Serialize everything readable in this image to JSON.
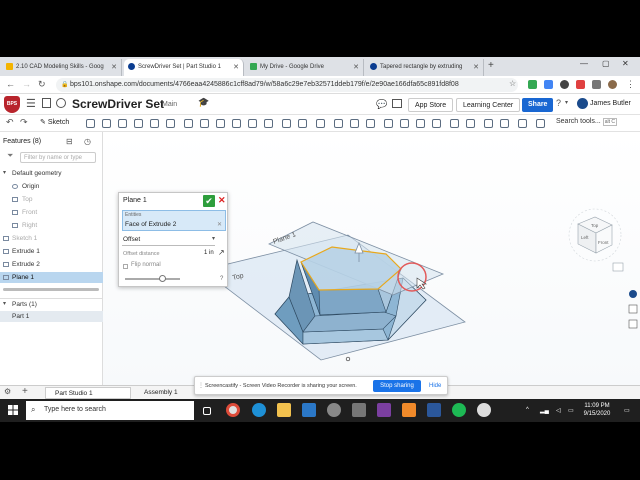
{
  "browser": {
    "tabs": [
      {
        "label": "2.10 CAD Modeling Skills - Goog",
        "color": "#f4b400",
        "active": false
      },
      {
        "label": "ScrewDriver Set | Part Studio 1",
        "color": "#0b3d91",
        "active": true
      },
      {
        "label": "My Drive - Google Drive",
        "color": "#34a853",
        "active": false
      },
      {
        "label": "Tapered rectangle by extruding",
        "color": "#0b3d91",
        "active": false
      }
    ],
    "url": "bps101.onshape.com/documents/4766eaa4245886c1cff8ad79/w/58a6c29e7eb32571ddeb179f/e/2e90ae166dfa65c891fd8f08"
  },
  "onshape": {
    "logo_text": "BPS",
    "doc_title": "ScrewDriver Set",
    "branch": "Main",
    "app_store": "App Store",
    "learning_center": "Learning Center",
    "share": "Share",
    "user": "James Butler",
    "sketch": "Sketch",
    "search_tools": "Search tools...",
    "search_shortcut": "alt C"
  },
  "features": {
    "title": "Features (8)",
    "filter_placeholder": "Filter by name or type",
    "items": [
      {
        "label": "Default geometry",
        "state": "normal"
      },
      {
        "label": "Origin",
        "state": "normal"
      },
      {
        "label": "Top",
        "state": "dim"
      },
      {
        "label": "Front",
        "state": "dim"
      },
      {
        "label": "Right",
        "state": "dim"
      },
      {
        "label": "Sketch 1",
        "state": "dim"
      },
      {
        "label": "Extrude 1",
        "state": "normal"
      },
      {
        "label": "Extrude 2",
        "state": "normal"
      },
      {
        "label": "Plane 1",
        "state": "selected"
      }
    ],
    "parts_title": "Parts (1)",
    "parts": [
      "Part 1"
    ]
  },
  "dialog": {
    "title": "Plane 1",
    "entities_label": "Entities",
    "entity": "Face of Extrude 2",
    "type": "Offset",
    "offset_label": "Offset distance",
    "offset_value": "1 in",
    "flip_label": "Flip normal"
  },
  "viewport": {
    "plane1_label": "Plane 1",
    "top_label": "Top",
    "cube_top": "Top",
    "cube_front": "Front",
    "cube_left": "Left"
  },
  "bottom_tabs": {
    "part_studio": "Part Studio 1",
    "assembly": "Assembly 1"
  },
  "screencastify": {
    "message": "Screencastify - Screen Video Recorder is sharing your screen.",
    "stop": "Stop sharing",
    "hide": "Hide"
  },
  "taskbar": {
    "search_placeholder": "Type here to search",
    "time": "11:09 PM",
    "date": "9/15/2020"
  }
}
